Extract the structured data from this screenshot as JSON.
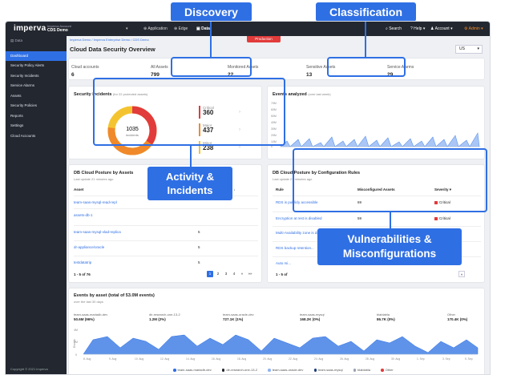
{
  "callouts": {
    "discovery": "Discovery",
    "classification": "Classification",
    "activity": "Activity &\nIncidents",
    "vulns": "Vulnerabilities &\nMisconfigurations"
  },
  "topbar": {
    "logo": "imperva",
    "account_label": "Imperva Account",
    "account_name": "CDS Demo",
    "tabs": [
      "Application",
      "Edge",
      "Data"
    ],
    "search": "Search",
    "help": "Help",
    "account_menu": "Account",
    "admin": "Admin"
  },
  "sidebar": {
    "header": "Data",
    "items": [
      "Dashboard",
      "Security Policy Alerts",
      "Security Incidents",
      "Service Alarms",
      "Assets",
      "Security Policies",
      "Reports",
      "Settings",
      "Cloud Accounts"
    ],
    "copyright": "Copyright © 2021 Imperva"
  },
  "main": {
    "breadcrumb": "Imperva Demo  /  Imperva Enterprise Demo  /  CDS Demo",
    "production_badge": "Production",
    "title": "Cloud Data Security Overview",
    "region": "US"
  },
  "stats": [
    {
      "label": "Cloud accounts",
      "value": "6"
    },
    {
      "label": "All Assets",
      "value": "799"
    },
    {
      "label": "Monitored Assets",
      "value": "22"
    },
    {
      "label": "Sensitive Assets",
      "value": "13"
    },
    {
      "label": "Service Alarms",
      "value": "29"
    }
  ],
  "incidents": {
    "title": "Security incidents",
    "subtitle": "(for 22 protected assets)",
    "total": "1035",
    "total_label": "incidents",
    "rows": [
      {
        "label": "Critical",
        "value": "360",
        "color": "#e23b3b"
      },
      {
        "label": "Major",
        "value": "437",
        "color": "#f0892a"
      },
      {
        "label": "Minor",
        "value": "238",
        "color": "#f4c430"
      }
    ]
  },
  "events_analyzed": {
    "title": "Events analyzed",
    "subtitle": "(over last week)",
    "y_ticks": [
      "70M",
      "60M",
      "50M",
      "40M",
      "30M",
      "20M",
      "10M",
      "0"
    ]
  },
  "posture_assets": {
    "title": "DB Cloud Posture by Assets",
    "subtitle": "Last update 21 minutes ago",
    "col_asset": "Asset",
    "col_rules": "Configuration Rules",
    "rows": [
      {
        "asset": "team-saas-mysql-read-repl",
        "value": ""
      },
      {
        "asset": "assets-db-1",
        "value": ""
      },
      {
        "asset": "team-saas-mysql-vlad-replica",
        "value": "5"
      },
      {
        "asset": "dr-appliance/oracle",
        "value": "5"
      },
      {
        "asset": "testdatatrip",
        "value": "5"
      }
    ],
    "pagination": "1 - 5 of 76",
    "pages": [
      "1",
      "2",
      "3",
      "4",
      "»",
      "»»"
    ]
  },
  "posture_rules": {
    "title": "DB Cloud Posture by Configuration Rules",
    "subtitle": "Last update 21 minutes ago",
    "col_rule": "Rule",
    "col_misc": "Misconfigured Assets",
    "col_sev": "Severity",
    "rows": [
      {
        "rule": "RDS is publicly accessible",
        "count": "69",
        "severity": "Critical",
        "color": "#e23b3b"
      },
      {
        "rule": "Encryption at rest is disabled",
        "count": "59",
        "severity": "Critical",
        "color": "#e23b3b"
      },
      {
        "rule": "Multi-Availability zone is disabled",
        "count": "73",
        "severity": "Major",
        "color": "#f0892a"
      },
      {
        "rule": "RDS backup retention...",
        "count": "",
        "severity": "",
        "color": "#f0892a"
      },
      {
        "rule": "Auto mi...",
        "count": "",
        "severity": "",
        "color": "#f4c430"
      }
    ],
    "pagination": "1 - 5 of",
    "next": "»"
  },
  "events_by_asset": {
    "title": "Events by asset (total of 53.0M events)",
    "subtitle": "over the last 30 days",
    "assets": [
      {
        "name": "team-saas-mariadb-dev",
        "value": "50.6M (96%)"
      },
      {
        "name": "dir-research-one-13-2",
        "value": "1.2M (2%)"
      },
      {
        "name": "team-saas-oracle-dev",
        "value": "727.1K (1%)"
      },
      {
        "name": "team-saas-mysql",
        "value": "168.2K (0%)"
      },
      {
        "name": "blablabla",
        "value": "86.7K (0%)"
      },
      {
        "name": "Other",
        "value": "170.4K (0%)"
      }
    ],
    "y_label": "Events",
    "y_ticks": [
      "4M",
      "2M",
      "0"
    ],
    "x_ticks": [
      "8. Aug",
      "9. Aug",
      "10. Aug",
      "12. Aug",
      "14. Aug",
      "16. Aug",
      "18. Aug",
      "20. Aug",
      "22. Aug",
      "24. Aug",
      "26. Aug",
      "28. Aug",
      "30. Aug",
      "1. Sep",
      "3. Sep",
      "5. Sep"
    ],
    "legend": [
      {
        "name": "team-saas-mariadb-dev",
        "color": "#2f6fe4"
      },
      {
        "name": "dir-research-one-13-2",
        "color": "#23272f"
      },
      {
        "name": "team-saas-oracle-dev",
        "color": "#8fb3f0"
      },
      {
        "name": "team-saas-mysql",
        "color": "#1f3e7a"
      },
      {
        "name": "blablabla",
        "color": "#9aa3b0"
      },
      {
        "name": "Other",
        "color": "#e23b3b"
      }
    ]
  }
}
